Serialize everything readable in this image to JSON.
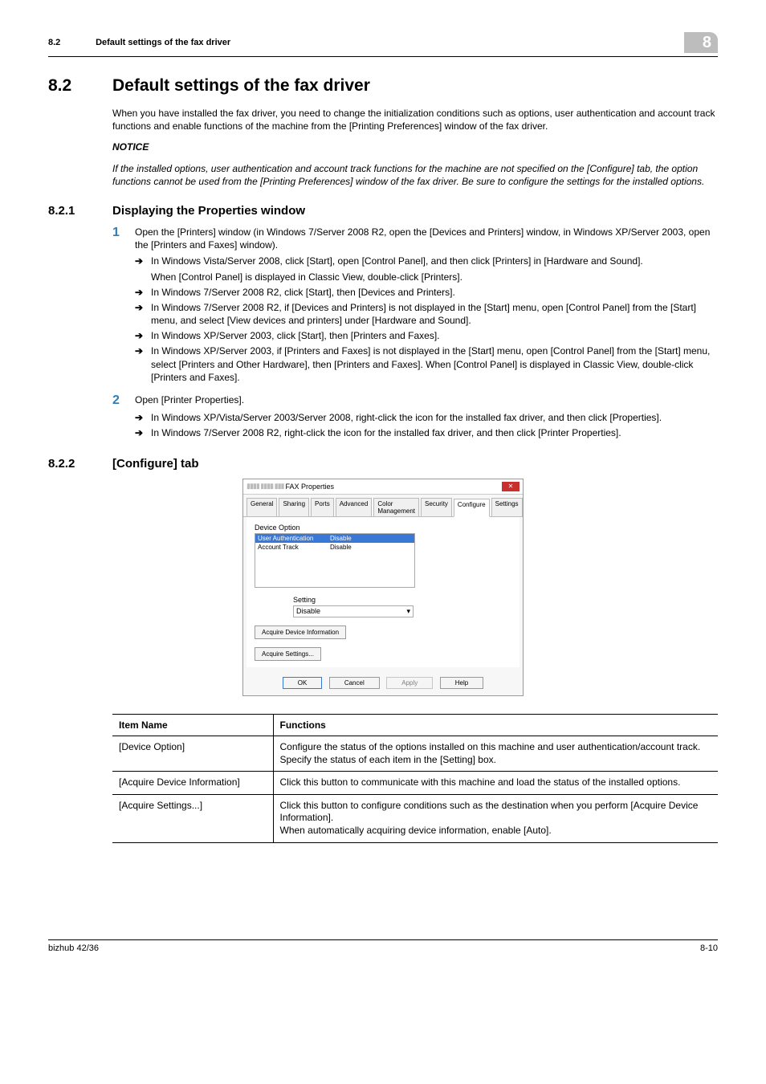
{
  "header": {
    "section_num": "8.2",
    "section_text": "Default settings of the fax driver",
    "chapter": "8"
  },
  "main": {
    "num": "8.2",
    "title": "Default settings of the fax driver",
    "intro": "When you have installed the fax driver, you need to change the initialization conditions such as options, user authentication and account track functions and enable functions of the machine from the [Printing Preferences] window of the fax driver.",
    "notice_label": "NOTICE",
    "notice_body": "If the installed options, user authentication and account track functions for the machine are not specified on the [Configure] tab, the option functions cannot be used from the [Printing Preferences] window of the fax driver. Be sure to configure the settings for the installed options."
  },
  "sub1": {
    "num": "8.2.1",
    "title": "Displaying the Properties window",
    "steps": [
      {
        "n": "1",
        "text": "Open the [Printers] window (in Windows 7/Server 2008 R2, open the [Devices and Printers] window, in Windows XP/Server 2003, open the [Printers and Faxes] window).",
        "subs": [
          {
            "text": "In Windows Vista/Server 2008, click [Start], open [Control Panel], and then click [Printers] in [Hardware and Sound].",
            "cont": "When [Control Panel] is displayed in Classic View, double-click [Printers]."
          },
          {
            "text": "In Windows 7/Server 2008 R2, click [Start], then [Devices and Printers]."
          },
          {
            "text": "In Windows 7/Server 2008 R2, if [Devices and Printers] is not displayed in the [Start] menu, open [Control Panel] from the [Start] menu, and select [View devices and printers] under [Hardware and Sound]."
          },
          {
            "text": "In Windows XP/Server 2003, click [Start], then [Printers and Faxes]."
          },
          {
            "text": "In Windows XP/Server 2003, if [Printers and Faxes] is not displayed in the [Start] menu, open [Control Panel] from the [Start] menu, select [Printers and Other Hardware], then [Printers and Faxes]. When [Control Panel] is displayed in Classic View, double-click [Printers and Faxes]."
          }
        ]
      },
      {
        "n": "2",
        "text": "Open [Printer Properties].",
        "subs": [
          {
            "text": "In Windows XP/Vista/Server 2003/Server 2008, right-click the icon for the installed fax driver, and then click [Properties]."
          },
          {
            "text": "In Windows 7/Server 2008 R2, right-click the icon for the installed fax driver, and then click [Printer Properties]."
          }
        ]
      }
    ]
  },
  "sub2": {
    "num": "8.2.2",
    "title": "[Configure] tab"
  },
  "dialog": {
    "title_suffix": "FAX Properties",
    "tabs": [
      "General",
      "Sharing",
      "Ports",
      "Advanced",
      "Color Management",
      "Security",
      "Configure",
      "Settings"
    ],
    "active_tab": "Configure",
    "group": "Device Option",
    "rows": [
      {
        "name": "User Authentication",
        "val": "Disable",
        "sel": true
      },
      {
        "name": "Account Track",
        "val": "Disable",
        "sel": false
      }
    ],
    "setting_label": "Setting",
    "setting_value": "Disable",
    "btn_acq_info": "Acquire Device Information",
    "btn_acq_set": "Acquire Settings...",
    "btn_ok": "OK",
    "btn_cancel": "Cancel",
    "btn_apply": "Apply",
    "btn_help": "Help"
  },
  "table": {
    "h1": "Item Name",
    "h2": "Functions",
    "rows": [
      {
        "name": "[Device Option]",
        "func": "Configure the status of the options installed on this machine and user authentication/account track. Specify the status of each item in the [Setting] box."
      },
      {
        "name": "[Acquire Device Information]",
        "func": "Click this button to communicate with this machine and load the status of the installed options."
      },
      {
        "name": "[Acquire Settings...]",
        "func": "Click this button to configure conditions such as the destination when you perform [Acquire Device Information].\nWhen automatically acquiring device information, enable [Auto]."
      }
    ]
  },
  "footer": {
    "left": "bizhub 42/36",
    "right": "8-10"
  }
}
